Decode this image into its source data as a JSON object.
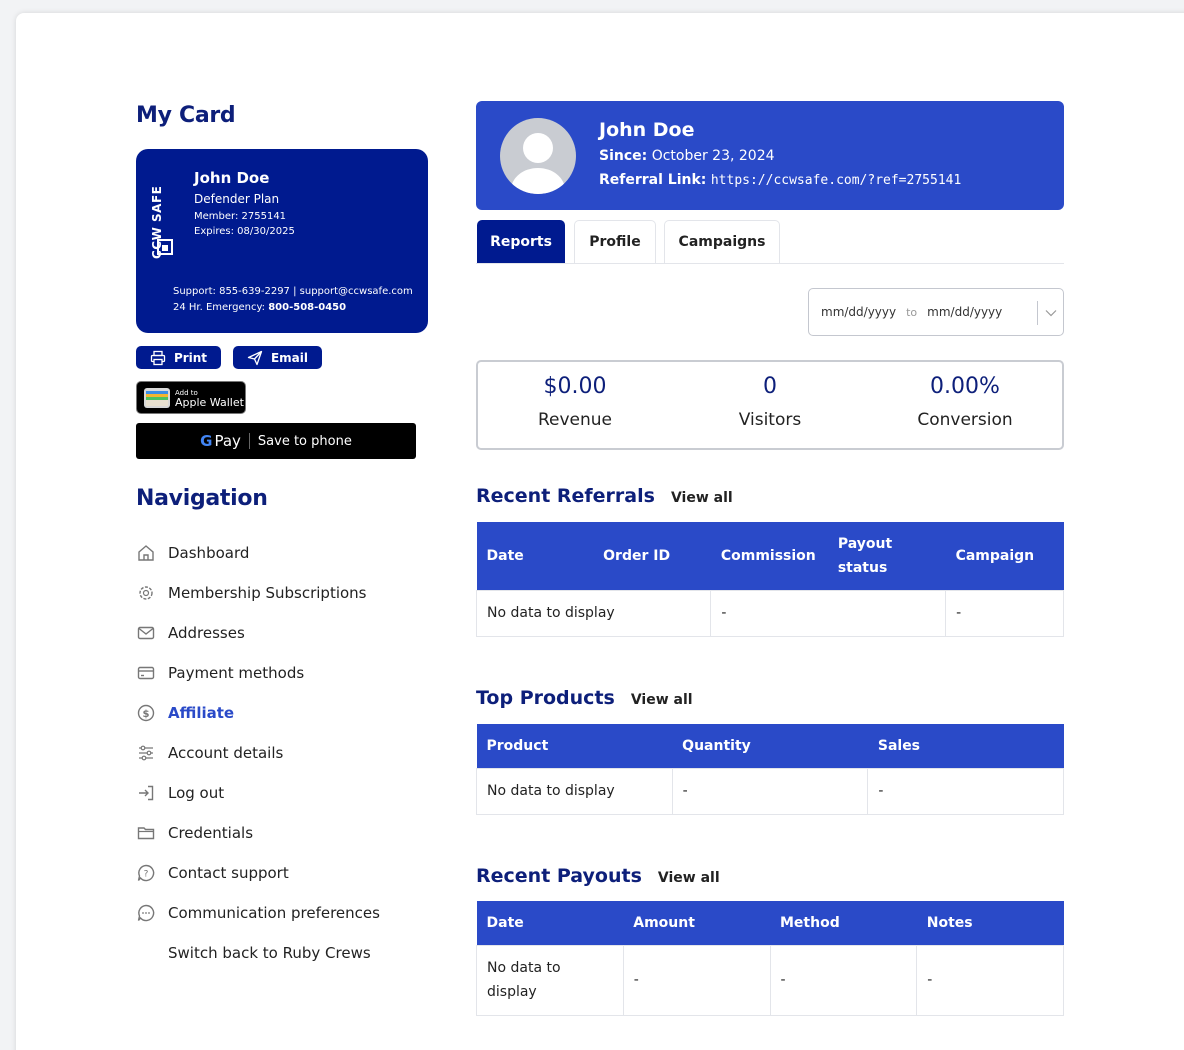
{
  "mycard": {
    "title": "My Card",
    "brand": "CCW SAFE",
    "name": "John Doe",
    "plan": "Defender Plan",
    "member": "Member: 2755141",
    "expires": "Expires: 08/30/2025",
    "support": "Support: 855-639-2297 | support@ccwsafe.com",
    "emergency_label": "24 Hr. Emergency:",
    "emergency_number": "800-508-0450",
    "print_label": "Print",
    "email_label": "Email",
    "wallet_small": "Add to",
    "wallet_big": "Apple Wallet",
    "gpay_label": "Pay",
    "gpay_action": "Save to phone"
  },
  "navigation": {
    "title": "Navigation",
    "items": [
      {
        "label": "Dashboard",
        "icon": "home-icon"
      },
      {
        "label": "Membership Subscriptions",
        "icon": "gear-icon"
      },
      {
        "label": "Addresses",
        "icon": "envelope-icon"
      },
      {
        "label": "Payment methods",
        "icon": "credit-card-icon"
      },
      {
        "label": "Affiliate",
        "icon": "dollar-icon",
        "active": true
      },
      {
        "label": "Account details",
        "icon": "sliders-icon"
      },
      {
        "label": "Log out",
        "icon": "logout-icon"
      },
      {
        "label": "Credentials",
        "icon": "folder-icon"
      },
      {
        "label": "Contact support",
        "icon": "help-chat-icon"
      },
      {
        "label": "Communication preferences",
        "icon": "chat-bubble-icon"
      },
      {
        "label": "Switch back to Ruby Crews",
        "icon": ""
      }
    ]
  },
  "profile": {
    "name": "John Doe",
    "since_label": "Since:",
    "since_value": "October 23, 2024",
    "referral_label": "Referral Link:",
    "referral_value": "https://ccwsafe.com/?ref=2755141"
  },
  "tabs": [
    {
      "label": "Reports",
      "active": true
    },
    {
      "label": "Profile"
    },
    {
      "label": "Campaigns"
    }
  ],
  "daterange": {
    "from": "mm/dd/yyyy",
    "to_label": "to",
    "to": "mm/dd/yyyy"
  },
  "stats": [
    {
      "value": "$0.00",
      "label": "Revenue"
    },
    {
      "value": "0",
      "label": "Visitors"
    },
    {
      "value": "0.00%",
      "label": "Conversion"
    }
  ],
  "referrals": {
    "title": "Recent Referrals",
    "view_all": "View all",
    "headers": [
      "Date",
      "Order ID",
      "Commission",
      "Payout status",
      "Campaign"
    ],
    "empty": "No data to display",
    "dash": "-"
  },
  "products": {
    "title": "Top Products",
    "view_all": "View all",
    "headers": [
      "Product",
      "Quantity",
      "Sales"
    ],
    "empty": "No data to display",
    "dash": "-"
  },
  "payouts": {
    "title": "Recent Payouts",
    "view_all": "View all",
    "headers": [
      "Date",
      "Amount",
      "Method",
      "Notes"
    ],
    "empty": "No data to display",
    "dash": "-"
  },
  "colors": {
    "primary_dark": "#001a8f",
    "primary": "#2a4ac8",
    "heading": "#0d1f7a"
  }
}
